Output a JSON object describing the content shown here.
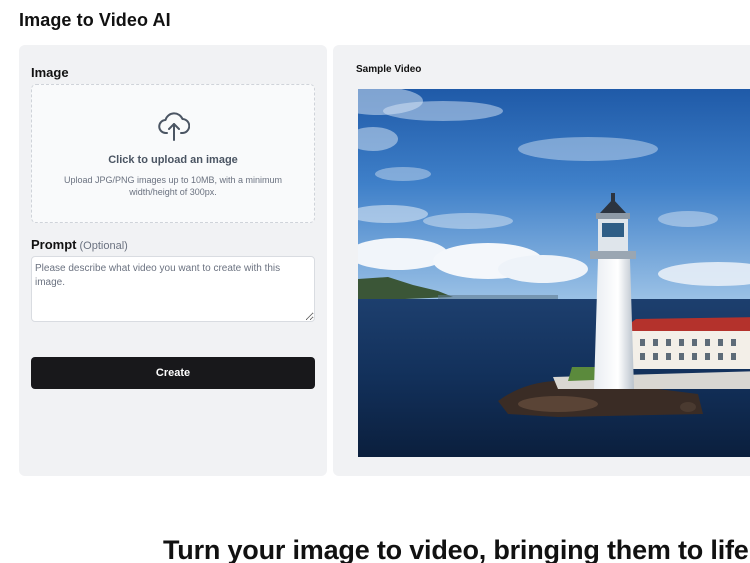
{
  "page": {
    "title": "Image to Video AI",
    "headline": "Turn your image to video, bringing them to life"
  },
  "form": {
    "image_label": "Image",
    "upload": {
      "icon": "cloud-upload-icon",
      "title": "Click to upload an image",
      "hint": "Upload JPG/PNG images up to 10MB, with a minimum width/height of 300px."
    },
    "prompt_label": "Prompt",
    "prompt_optional": "(Optional)",
    "prompt_placeholder": "Please describe what video you want to create with this image.",
    "create_label": "Create"
  },
  "sample": {
    "label": "Sample Video",
    "scene": "lighthouse-by-the-sea"
  },
  "colors": {
    "panel_bg": "#f1f2f4",
    "button_bg": "#18181b",
    "button_text": "#ffffff"
  }
}
